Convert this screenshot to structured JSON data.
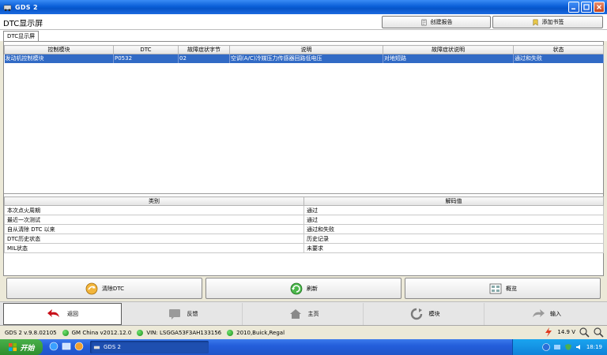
{
  "window": {
    "title": "GDS 2"
  },
  "header": {
    "page_title": "DTC显示屏",
    "create_report": "创建报告",
    "add_bookmark": "添加书签"
  },
  "tabs": [
    {
      "label": "DTC显示屏"
    }
  ],
  "dtc_table": {
    "columns": [
      "控制模块",
      "DTC",
      "故障症状字节",
      "说明",
      "故障症状说明",
      "状态"
    ],
    "rows": [
      {
        "module": "发动机控制模块",
        "dtc": "P0532",
        "symptom_byte": "02",
        "description": "空调(A/C)冷媒压力传感器回路低电压",
        "symptom_description": "对地短路",
        "status": "通过和失败"
      }
    ]
  },
  "info_table": {
    "columns": [
      "类别",
      "解码值"
    ],
    "rows": [
      {
        "category": "本次点火周期",
        "value": "通过"
      },
      {
        "category": "最近一次测试",
        "value": "通过"
      },
      {
        "category": "自从清除 DTC 以来",
        "value": "通过和失败"
      },
      {
        "category": "DTC历史状态",
        "value": "历史记录"
      },
      {
        "category": "MIL状态",
        "value": "未要求"
      }
    ]
  },
  "actions": {
    "clear_dtc": "清除DTC",
    "refresh": "刷新",
    "overview": "概览"
  },
  "nav": {
    "back": "返回",
    "feedback": "反馈",
    "home": "主页",
    "module": "模块",
    "input": "输入"
  },
  "status": {
    "version": "GDS 2 v.9.8.02105",
    "gm_china": "GM China v2012.12.0",
    "vin": "VIN: LSGGA53F3AH133156",
    "vehicle": "2010,Buick,Regal",
    "voltage": "14.9 V"
  },
  "taskbar": {
    "start": "开始",
    "task": "GDS 2",
    "clock": "18:19"
  },
  "colors": {
    "selection": "#316ac5",
    "titlebar": "#0a5fd8",
    "status_ok": "#1c8a1c"
  }
}
